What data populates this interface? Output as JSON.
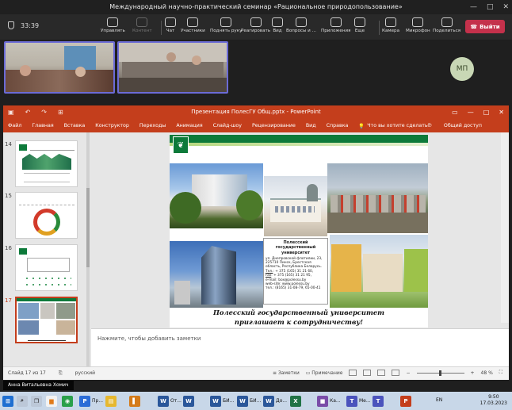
{
  "meeting": {
    "title": "Международный научно-практический семинар «Рациональное природопользование»",
    "timer": "33:39",
    "tools": [
      {
        "label": "Управлять",
        "icon": "share-control-icon",
        "dim": false
      },
      {
        "label": "Контент",
        "icon": "content-icon",
        "dim": true
      },
      {
        "label": "Чат",
        "icon": "chat-icon",
        "dim": false
      },
      {
        "label": "Участники",
        "icon": "people-icon",
        "dim": false
      },
      {
        "label": "Поднять руку",
        "icon": "raise-hand-icon",
        "dim": false
      },
      {
        "label": "Реагировать",
        "icon": "react-icon",
        "dim": false
      },
      {
        "label": "Вид",
        "icon": "view-icon",
        "dim": false
      },
      {
        "label": "Вопросы и ...",
        "icon": "qa-icon",
        "dim": false
      },
      {
        "label": "Приложения",
        "icon": "apps-icon",
        "dim": false
      },
      {
        "label": "Еще",
        "icon": "more-icon",
        "dim": false
      },
      {
        "label": "Камера",
        "icon": "camera-icon",
        "dim": false
      },
      {
        "label": "Микрофон",
        "icon": "microphone-icon",
        "dim": false
      },
      {
        "label": "Поделиться",
        "icon": "share-icon",
        "dim": false
      }
    ],
    "leave_label": "Выйти",
    "avatar_initials": "МП",
    "presenter_name": "Анна Витальевна Хомич"
  },
  "ppt": {
    "title": "Презентация ПолесГУ Общ.pptx  -  PowerPoint",
    "menu": [
      "Файл",
      "Главная",
      "Вставка",
      "Конструктор",
      "Переходы",
      "Анимация",
      "Слайд-шоу",
      "Рецензирование",
      "Вид",
      "Справка"
    ],
    "tell_me": "Что вы хотите сделать?",
    "share": "Общий доступ",
    "thumbnails": [
      {
        "num": "14",
        "selected": false
      },
      {
        "num": "15",
        "selected": false
      },
      {
        "num": "16",
        "selected": false
      },
      {
        "num": "17",
        "selected": true
      }
    ],
    "notes_placeholder": "Нажмите, чтобы добавить заметки",
    "status": {
      "slide": "Слайд 17 из 17",
      "language": "русский",
      "notes": "Заметки",
      "comments": "Примечание",
      "zoom": "48 %"
    }
  },
  "slide": {
    "university_name": "Полесский государственный университет",
    "address": "ул. Днепровской флотилии, 23, 225710 Пинск, Брестская область, Республика Беларусь.",
    "tel_label": "Тел.",
    "tel": ": + 375 (165) 31 21 60,",
    "fax_label": "Fax",
    "fax": ": + 375 (165) 31 21 95,",
    "email": "e-mail: box@polessu.by",
    "website": "web-site: www.polessu.by",
    "tel2": "тел.: (8165) 31-08-79, 65-00-41",
    "caption_line1": "Полесский государственный университет",
    "caption_line2": "приглашает к сотрудничеству!"
  },
  "taskbar": {
    "items": [
      {
        "label": "Пр...",
        "color": "#2b6cd6",
        "glyph": "P"
      },
      {
        "label": "",
        "color": "#e6b830",
        "glyph": "▤"
      },
      {
        "label": "",
        "color": "#d47b1a",
        "glyph": "▌"
      },
      {
        "label": "От...",
        "color": "#2b579a",
        "glyph": "W"
      },
      {
        "label": "",
        "color": "#2b579a",
        "glyph": "W"
      },
      {
        "label": "БИ...",
        "color": "#2b579a",
        "glyph": "W"
      },
      {
        "label": "БИ...",
        "color": "#2b579a",
        "glyph": "W"
      },
      {
        "label": "До...",
        "color": "#2b579a",
        "glyph": "W"
      },
      {
        "label": "",
        "color": "#217346",
        "glyph": "X"
      },
      {
        "label": "Ка...",
        "color": "#7a4ca8",
        "glyph": "■"
      },
      {
        "label": "Ме...",
        "color": "#4b53bc",
        "glyph": "T"
      },
      {
        "label": "",
        "color": "#4b53bc",
        "glyph": "T"
      },
      {
        "label": "",
        "color": "#c43e1c",
        "glyph": "P"
      }
    ],
    "lang": "EN",
    "time": "9:50",
    "date": "17.03.2023"
  }
}
